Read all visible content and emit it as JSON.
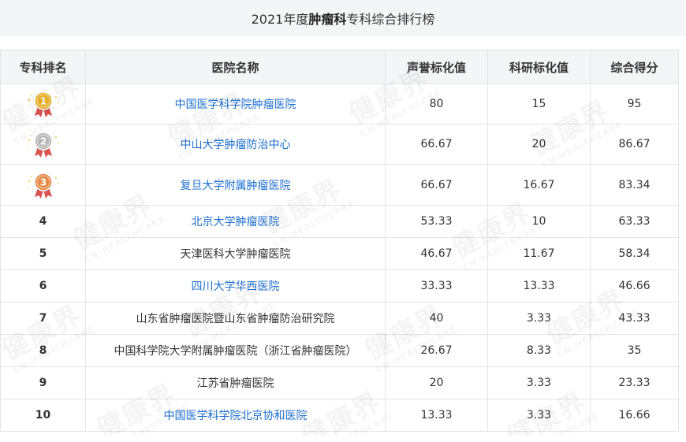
{
  "title": {
    "pre": "2021年度",
    "bold": "肿瘤科",
    "post": "专科综合排行榜"
  },
  "columns": [
    "专科排名",
    "医院名称",
    "声誉标化值",
    "科研标化值",
    "综合得分"
  ],
  "rows": [
    {
      "rank": "1",
      "medal": "gold",
      "hospital": "中国医学科学院肿瘤医院",
      "link": true,
      "reputation": "80",
      "research": "15",
      "total": "95"
    },
    {
      "rank": "2",
      "medal": "silver",
      "hospital": "中山大学肿瘤防治中心",
      "link": true,
      "reputation": "66.67",
      "research": "20",
      "total": "86.67"
    },
    {
      "rank": "3",
      "medal": "bronze",
      "hospital": "复旦大学附属肿瘤医院",
      "link": true,
      "reputation": "66.67",
      "research": "16.67",
      "total": "83.34"
    },
    {
      "rank": "4",
      "medal": "",
      "hospital": "北京大学肿瘤医院",
      "link": true,
      "reputation": "53.33",
      "research": "10",
      "total": "63.33"
    },
    {
      "rank": "5",
      "medal": "",
      "hospital": "天津医科大学肿瘤医院",
      "link": false,
      "reputation": "46.67",
      "research": "11.67",
      "total": "58.34"
    },
    {
      "rank": "6",
      "medal": "",
      "hospital": "四川大学华西医院",
      "link": true,
      "reputation": "33.33",
      "research": "13.33",
      "total": "46.66"
    },
    {
      "rank": "7",
      "medal": "",
      "hospital": "山东省肿瘤医院暨山东省肿瘤防治研究院",
      "link": false,
      "reputation": "40",
      "research": "3.33",
      "total": "43.33"
    },
    {
      "rank": "8",
      "medal": "",
      "hospital": "中国科学院大学附属肿瘤医院（浙江省肿瘤医院）",
      "link": false,
      "reputation": "26.67",
      "research": "8.33",
      "total": "35"
    },
    {
      "rank": "9",
      "medal": "",
      "hospital": "江苏省肿瘤医院",
      "link": false,
      "reputation": "20",
      "research": "3.33",
      "total": "23.33"
    },
    {
      "rank": "10",
      "medal": "",
      "hospital": "中国医学科学院北京协和医院",
      "link": true,
      "reputation": "13.33",
      "research": "3.33",
      "total": "16.66"
    }
  ],
  "watermark": {
    "big": "健康界",
    "small": "CN-HEALTHCARE"
  },
  "colors": {
    "link": "#1f6fd0",
    "header_bg": "#f4f5f7",
    "gold": "#f0b62a",
    "silver": "#b9b9b9",
    "bronze": "#e58b46",
    "ribbon": "#d9534f"
  }
}
